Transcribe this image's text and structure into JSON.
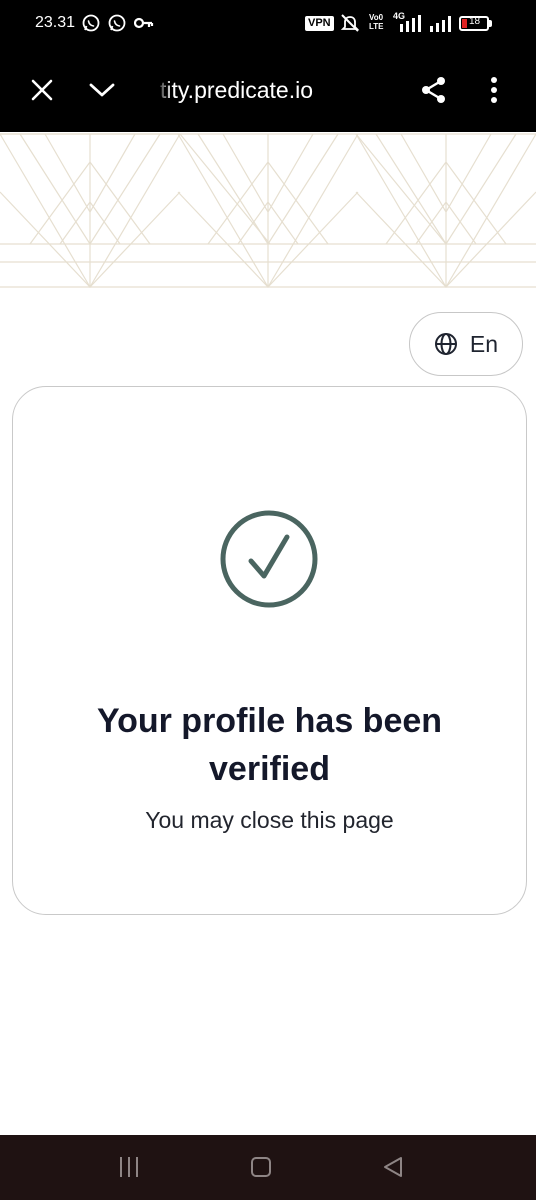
{
  "status_bar": {
    "time": "23.31",
    "vpn_label": "VPN",
    "volte_line1": "Vo0",
    "volte_line2": "LTE",
    "network": "4G",
    "battery": "18",
    "icons": [
      "whatsapp-icon",
      "whatsapp-icon",
      "key-icon",
      "mute-icon",
      "signal-icon",
      "signal-icon"
    ]
  },
  "browser": {
    "url": "tity.predicate.io",
    "icons": [
      "close-icon",
      "chevron-down-icon",
      "share-icon",
      "more-vert-icon"
    ]
  },
  "language": {
    "label": "En",
    "icon": "globe-icon"
  },
  "card": {
    "icon": "check-circle-icon",
    "title_line1": "Your profile has been",
    "title_line2": "verified",
    "subtitle": "You may close this page"
  },
  "nav_bar": {
    "icons": [
      "recent-apps-icon",
      "home-icon",
      "back-icon"
    ]
  },
  "colors": {
    "accent_check": "#4a6560",
    "pattern_line": "#e6dfd0",
    "title_text": "#14182a",
    "nav_bg": "#1f1212"
  }
}
